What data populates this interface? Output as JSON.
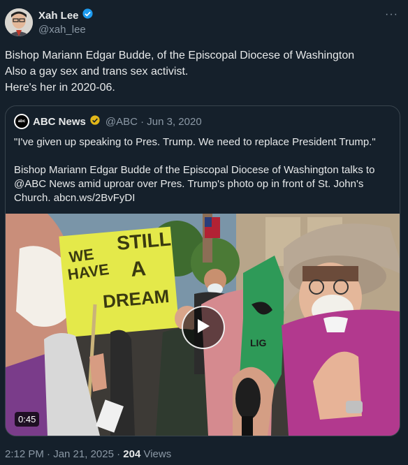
{
  "tweet": {
    "author_name": "Xah Lee",
    "author_handle": "@xah_lee",
    "text_lines": [
      "Bishop Mariann Edgar Budde, of the Episcopal Diocese of Washington",
      "Also a gay sex and trans sex activist.",
      "Here's her in 2020-06."
    ],
    "timestamp": "2:12 PM · Jan 21, 2025",
    "views_count": "204",
    "views_label": "Views",
    "more_label": "···"
  },
  "quote": {
    "author_name": "ABC News",
    "author_meta": "@ABC · Jun 3, 2020",
    "logo_text": "abc",
    "lines": [
      "\"I've given up speaking to Pres. Trump. We need to replace President Trump.\"",
      "Bishop Mariann Edgar Budde of the Episcopal Diocese of Washington talks to",
      "@ABC News amid uproar over Pres. Trump's photo op in front of St. John's",
      "Church. abcn.ws/2BvFyDI"
    ],
    "video": {
      "duration": "0:45",
      "sign_line1": "WE",
      "sign_line2": "HAVE",
      "sign2_line1": "STILL",
      "sign2_line2": "A",
      "sign2_line3": "DREAM",
      "stole_text": "LIG"
    }
  },
  "colors": {
    "background": "#15202b",
    "verified": "#1d9bf0",
    "gold_badge": "#e2b719",
    "muted": "#8b98a5",
    "border": "#38444d"
  },
  "icons": [
    "verified-badge-icon",
    "gold-verified-badge-icon",
    "play-icon",
    "more-icon"
  ]
}
